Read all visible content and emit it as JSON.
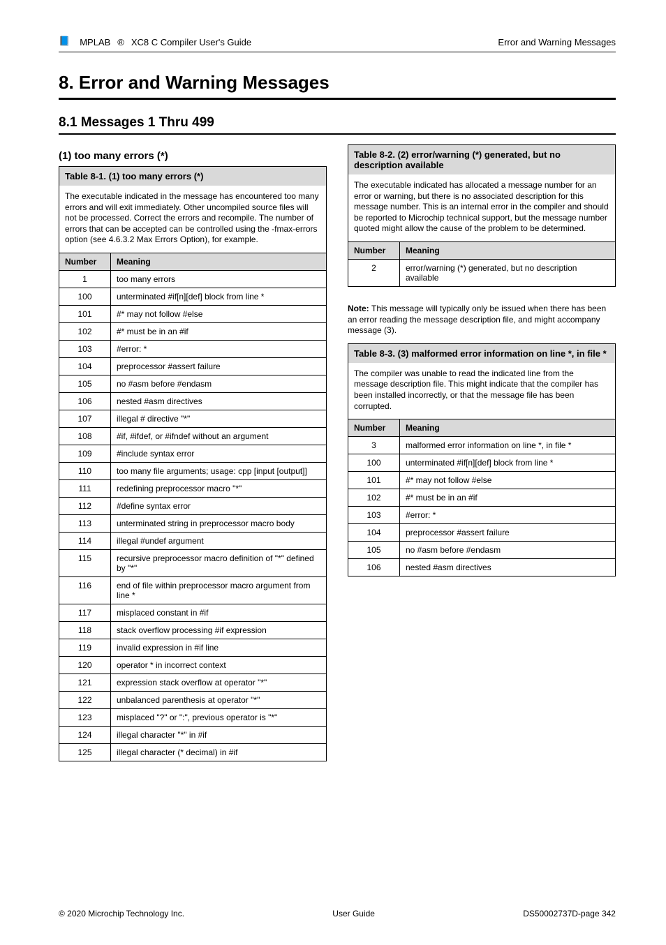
{
  "header": {
    "l1": "MPLAB",
    "l2": "®",
    "l3": " XC8 C Compiler User's Guide",
    "right": "Error and Warning Messages"
  },
  "title": "8. Error and Warning Messages",
  "sub": "8.1 Messages 1 Thru 499",
  "col1": {
    "subsub": "(1) too many errors (*)",
    "cap": "Table 8-1. (1) too many errors (*)",
    "desc": "The executable indicated in the message has encountered too many errors and will exit immediately. Other uncompiled source files will not be processed. Correct the errors and recompile. The number of errors that can be accepted can be controlled using the -fmax-errors option (see 4.6.3.2 Max Errors Option), for example.",
    "rows": [
      [
        "1",
        "too many errors"
      ],
      [
        "100",
        "unterminated #if[n][def] block from line *"
      ],
      [
        "101",
        "#* may not follow #else"
      ],
      [
        "102",
        "#* must be in an #if"
      ],
      [
        "103",
        "#error: *"
      ],
      [
        "104",
        "preprocessor #assert failure"
      ],
      [
        "105",
        "no #asm before #endasm"
      ],
      [
        "106",
        "nested #asm directives"
      ],
      [
        "107",
        "illegal # directive \"*\""
      ],
      [
        "108",
        "#if, #ifdef, or #ifndef without an argument"
      ],
      [
        "109",
        "#include syntax error"
      ],
      [
        "110",
        "too many file arguments; usage: cpp [input [output]]"
      ],
      [
        "111",
        "redefining preprocessor macro \"*\""
      ],
      [
        "112",
        "#define syntax error"
      ],
      [
        "113",
        "unterminated string in preprocessor macro body"
      ],
      [
        "114",
        "illegal #undef argument"
      ],
      [
        "115",
        "recursive preprocessor macro definition of \"*\" defined by \"*\""
      ],
      [
        "116",
        "end of file within preprocessor macro argument from line *"
      ],
      [
        "117",
        "misplaced constant in #if"
      ],
      [
        "118",
        "stack overflow processing #if expression"
      ],
      [
        "119",
        "invalid expression in #if line"
      ],
      [
        "120",
        "operator * in incorrect context"
      ],
      [
        "121",
        "expression stack overflow at operator \"*\""
      ],
      [
        "122",
        "unbalanced parenthesis at operator \"*\""
      ],
      [
        "123",
        "misplaced \"?\" or \":\", previous operator is \"*\""
      ],
      [
        "124",
        "illegal character \"*\" in #if"
      ],
      [
        "125",
        "illegal character (* decimal) in #if"
      ]
    ]
  },
  "col2_a": {
    "cap": "Table 8-2. (2) error/warning (*) generated, but no description available",
    "desc": "The executable indicated has allocated a message number for an error or warning, but there is no associated description for this message number. This is an internal error in the compiler and should be reported to Microchip technical support, but the message number quoted might allow the cause of the problem to be determined.",
    "rows": [
      [
        "2",
        "error/warning (*) generated, but no description available"
      ]
    ]
  },
  "note": {
    "b": "Note: ",
    "t": "This message will typically only be issued when there has been an error reading the message description file, and might accompany message (3)."
  },
  "col2_b": {
    "cap": "Table 8-3. (3) malformed error information on line *, in file *",
    "desc": "The compiler was unable to read the indicated line from the message description file. This might indicate that the compiler has been installed incorrectly, or that the message file has been corrupted.",
    "rows": [
      [
        "3",
        "malformed error information on line *, in file *"
      ],
      [
        "100",
        "unterminated #if[n][def] block from line *"
      ],
      [
        "101",
        "#* may not follow #else"
      ],
      [
        "102",
        "#* must be in an #if"
      ],
      [
        "103",
        "#error: *"
      ],
      [
        "104",
        "preprocessor #assert failure"
      ],
      [
        "105",
        "no #asm before #endasm"
      ],
      [
        "106",
        "nested #asm directives"
      ]
    ]
  },
  "colhead": {
    "a": "Number",
    "b": "Meaning"
  },
  "footer": {
    "left": "© 2020 Microchip Technology Inc.",
    "mid": "User Guide",
    "right": "DS50002737D-page 342"
  }
}
